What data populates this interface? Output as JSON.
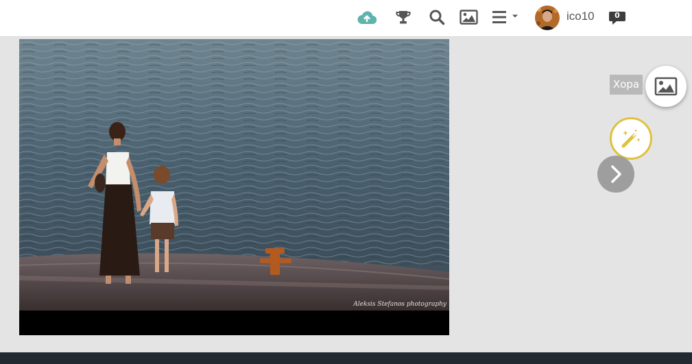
{
  "header": {
    "icons": [
      {
        "name": "upload-cloud-icon",
        "color": "#5fb3ad"
      },
      {
        "name": "trophy-icon",
        "color": "#555555"
      },
      {
        "name": "search-icon",
        "color": "#555555"
      },
      {
        "name": "image-icon",
        "color": "#555555"
      },
      {
        "name": "menu-icon",
        "color": "#555555"
      }
    ],
    "user": {
      "username": "ico10",
      "avatar_icon": "user-avatar"
    },
    "notifications": {
      "icon": "chat-bubble-icon",
      "count": "0"
    }
  },
  "photo": {
    "signature": "Aleksis Stefanos photography"
  },
  "side_controls": {
    "category_label": "Хора",
    "gallery_icon": "image-icon",
    "magic_icon": "magic-wand-icon",
    "next_icon": "chevron-right-icon",
    "accent_color": "#dfc13d"
  }
}
